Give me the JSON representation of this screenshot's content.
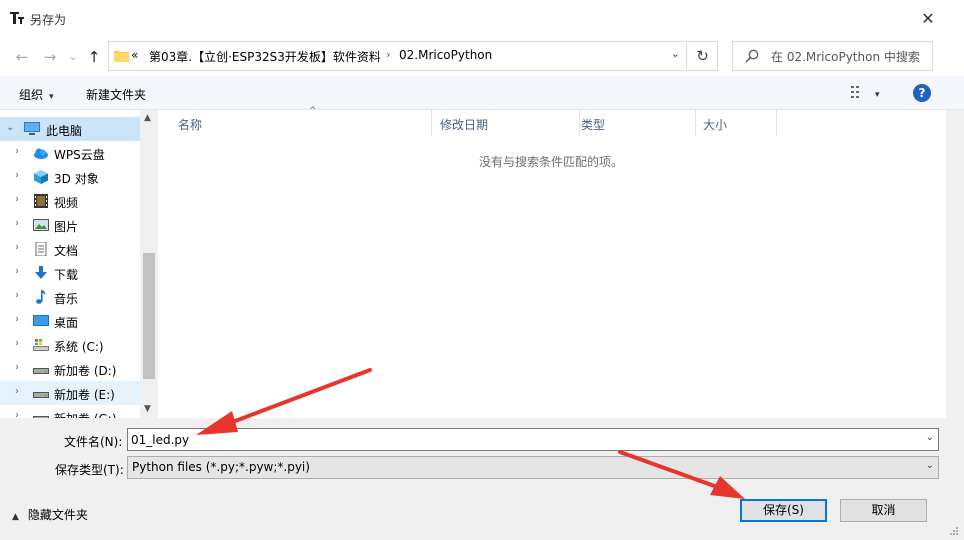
{
  "window": {
    "title": "另存为",
    "close_glyph": "✕"
  },
  "nav": {
    "back_glyph": "←",
    "forward_glyph": "→",
    "recent_glyph": "⌄",
    "up_glyph": "↑",
    "refresh_glyph": "↻"
  },
  "address": {
    "overflow": "«",
    "crumbs": [
      "第03章.【立创·ESP32S3开发板】软件资料",
      "02.MricoPython"
    ],
    "dropdown_glyph": "⌄"
  },
  "search": {
    "placeholder": "在 02.MricoPython 中搜索"
  },
  "toolbar": {
    "organize_label": "组织",
    "new_folder_label": "新建文件夹",
    "caret": "▾",
    "help_glyph": "?"
  },
  "tree": {
    "items": [
      {
        "label": "此电脑",
        "icon": "computer-icon",
        "expanded": true,
        "selected": true
      },
      {
        "label": "WPS云盘",
        "icon": "cloud-icon"
      },
      {
        "label": "3D 对象",
        "icon": "cube-icon"
      },
      {
        "label": "视频",
        "icon": "video-icon"
      },
      {
        "label": "图片",
        "icon": "picture-icon"
      },
      {
        "label": "文档",
        "icon": "document-icon"
      },
      {
        "label": "下载",
        "icon": "download-icon"
      },
      {
        "label": "音乐",
        "icon": "music-icon"
      },
      {
        "label": "桌面",
        "icon": "desktop-icon"
      },
      {
        "label": "系统 (C:)",
        "icon": "drive-icon"
      },
      {
        "label": "新加卷 (D:)",
        "icon": "drive-icon"
      },
      {
        "label": "新加卷 (E:)",
        "icon": "drive-icon",
        "hover": true
      },
      {
        "label": "新加卷 (G:)",
        "icon": "drive-icon"
      }
    ],
    "chevron_closed": "›",
    "chevron_open": "⌄"
  },
  "columns": {
    "name": "名称",
    "date": "修改日期",
    "type": "类型",
    "size": "大小",
    "sort_glyph": "^"
  },
  "content": {
    "empty_message": "没有与搜索条件匹配的项。"
  },
  "form": {
    "filename_label": "文件名(N):",
    "filename_value": "01_led.py",
    "filetype_label": "保存类型(T):",
    "filetype_value": "Python files (*.py;*.pyw;*.pyi)",
    "dropdown_glyph": "⌄"
  },
  "footer": {
    "hide_folders_label": "隐藏文件夹",
    "caret": "▲",
    "save_label": "保存(S)",
    "cancel_label": "取消"
  },
  "colors": {
    "selection": "#cce4f7",
    "accent": "#0078d7",
    "annotation_arrow": "#e8352b",
    "help": "#1e63c4"
  }
}
